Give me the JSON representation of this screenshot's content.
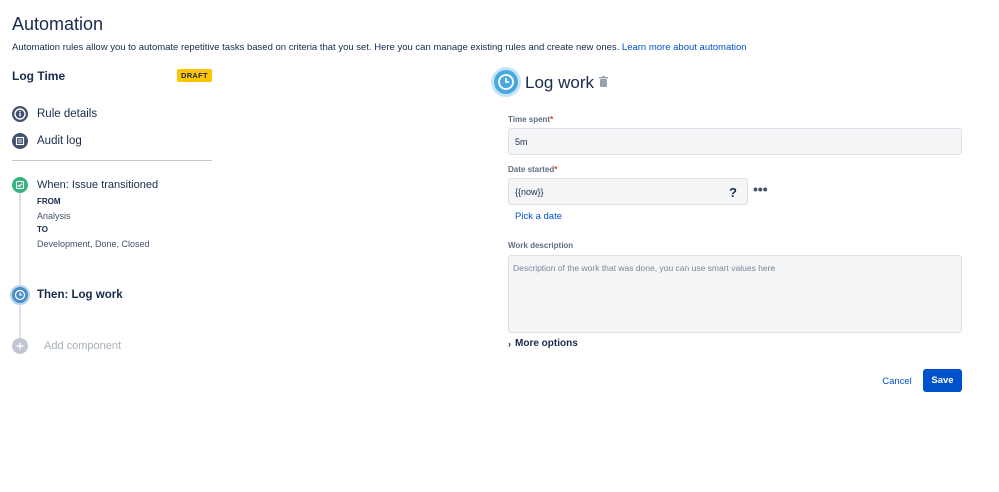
{
  "page": {
    "title": "Automation",
    "description": "Automation rules allow you to automate repetitive tasks based on criteria that you set. Here you can manage existing rules and create new ones.",
    "learn_more": "Learn more about automation"
  },
  "rule": {
    "name": "Log Time",
    "status_badge": "DRAFT"
  },
  "nav": {
    "rule_details": "Rule details",
    "audit_log": "Audit log"
  },
  "trigger": {
    "title": "When: Issue transitioned",
    "from_label": "FROM",
    "from_value": "Analysis",
    "to_label": "TO",
    "to_value": "Development, Done, Closed"
  },
  "action": {
    "title": "Then: Log work"
  },
  "add_component": "Add component",
  "editor": {
    "title": "Log work",
    "time_spent_label": "Time spent",
    "time_spent_value": "5m",
    "date_started_label": "Date started",
    "date_started_value": "{{now}}",
    "help_glyph": "?",
    "more_glyph": "•••",
    "pick_date": "Pick a date",
    "work_description_label": "Work description",
    "work_description_placeholder": "Description of the work that was done, you can use smart values here",
    "more_options": "More options",
    "cancel": "Cancel",
    "save": "Save",
    "required_marker": "*"
  },
  "colors": {
    "accent": "#0052cc",
    "draft_badge": "#ffc400",
    "trigger_green": "#36b37e",
    "action_blue": "#4aa8e0"
  }
}
